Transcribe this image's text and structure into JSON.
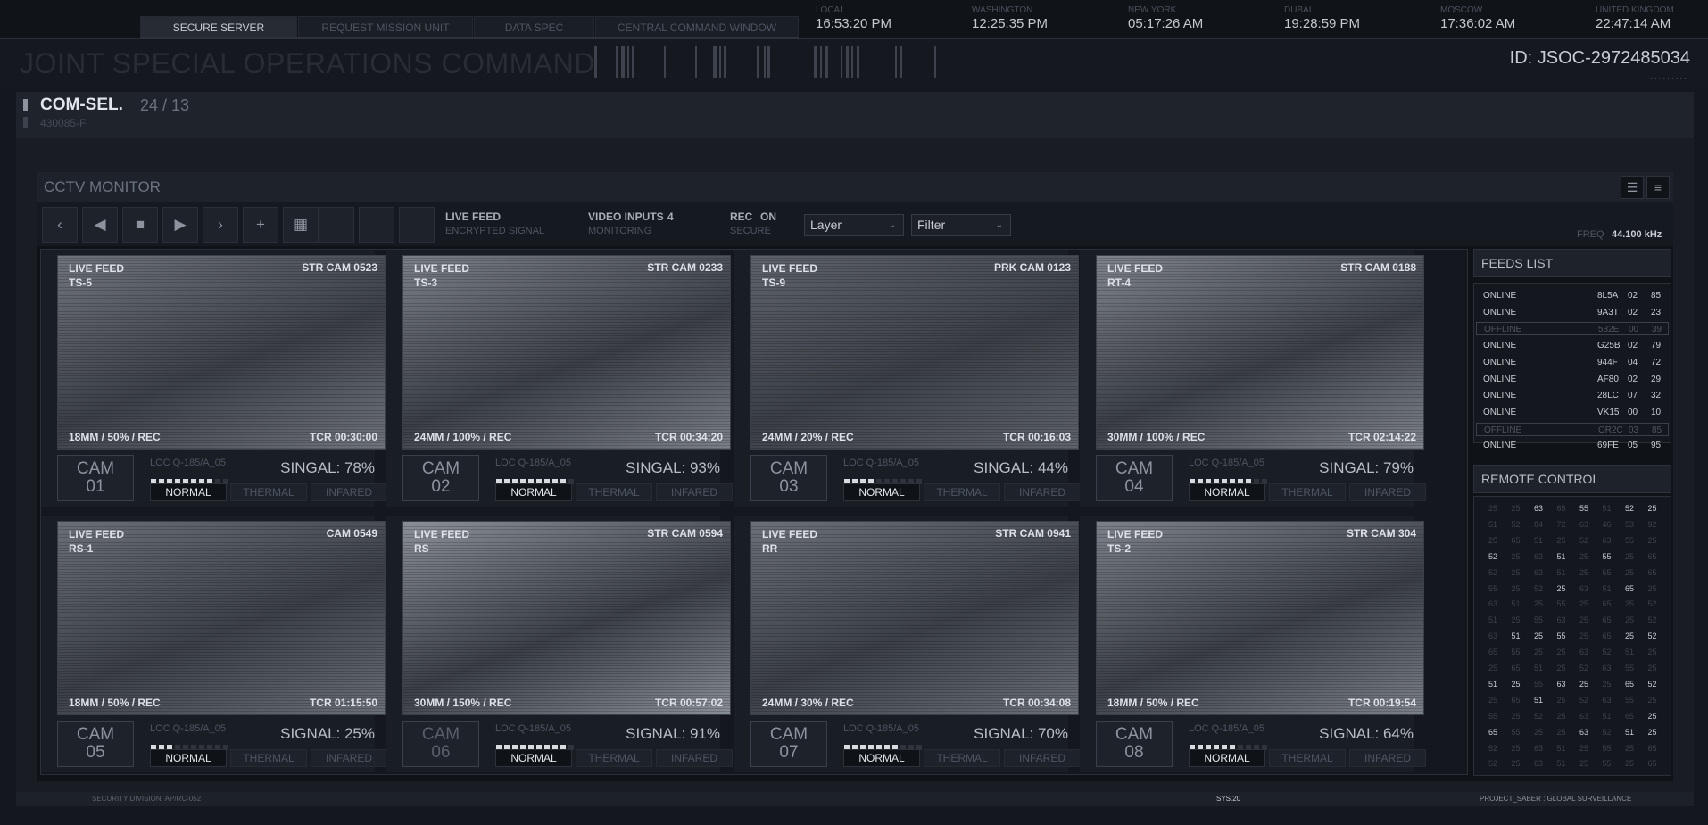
{
  "nav": {
    "tabs": [
      {
        "label": "SECURE SERVER"
      },
      {
        "label": "REQUEST MISSION UNIT"
      },
      {
        "label": "DATA SPEC"
      },
      {
        "label": "CENTRAL COMMAND WINDOW"
      }
    ]
  },
  "clocks": [
    {
      "city": "LOCAL",
      "time": "16:53:20  PM"
    },
    {
      "city": "WASHINGTON",
      "time": "12:25:35  PM"
    },
    {
      "city": "NEW YORK",
      "time": "05:17:26  AM"
    },
    {
      "city": "DUBAI",
      "time": "19:28:59  PM"
    },
    {
      "city": "MOSCOW",
      "time": "17:36:02  AM"
    },
    {
      "city": "UNITED KINGDOM",
      "time": "22:47:14  AM"
    }
  ],
  "header": {
    "title": "JOINT SPECIAL OPERATIONS COMMAND",
    "id_label": "ID:  JSOC-2972485034",
    "id_dots": "........."
  },
  "comsel": {
    "title": "COM-SEL.",
    "count": "24 / 13",
    "sub": "430085-F"
  },
  "cctv": {
    "title": "CCTV MONITOR",
    "live_feed": "LIVE FEED",
    "encrypted": "ENCRYPTED SIGNAL",
    "video_inputs": "VIDEO INPUTS",
    "video_inputs_count": "4",
    "monitoring": "MONITORING",
    "rec": "REC",
    "rec_status": "ON",
    "secure": "SECURE",
    "layer": "Layer",
    "filter": "Filter",
    "freq_label": "FREQ",
    "freq_value": "44.100 kHz"
  },
  "cameras": [
    {
      "tl1": "LIVE FEED",
      "tl2": "TS-5",
      "tr": "STR CAM 0523",
      "bl": "18MM / 50% / REC",
      "br": "TCR 00:30:00",
      "cam": "CAM",
      "num": "01",
      "loc": "LOC Q-185/A_05",
      "signal": "SINGAL: 78%",
      "level": 0.78,
      "shade": "#6f747c",
      "dim": false
    },
    {
      "tl1": "LIVE FEED",
      "tl2": "TS-3",
      "tr": "STR CAM 0233",
      "bl": "24MM / 100% / REC",
      "br": "TCR 00:34:20",
      "cam": "CAM",
      "num": "02",
      "loc": "LOC Q-185/A_05",
      "signal": "SINGAL: 93%",
      "level": 0.93,
      "shade": "#7a7f88",
      "dim": false
    },
    {
      "tl1": "LIVE FEED",
      "tl2": "TS-9",
      "tr": "PRK CAM 0123",
      "bl": "24MM / 20% / REC",
      "br": "TCR 00:16:03",
      "cam": "CAM",
      "num": "03",
      "loc": "LOC Q-185/A_05",
      "signal": "SINGAL: 44%",
      "level": 0.44,
      "shade": "#5e636b",
      "dim": false
    },
    {
      "tl1": "LIVE FEED",
      "tl2": "RT-4",
      "tr": "STR CAM 0188",
      "bl": "30MM / 100% / REC",
      "br": "TCR 02:14:22",
      "cam": "CAM",
      "num": "04",
      "loc": "LOC Q-185/A_05",
      "signal": "SINGAL: 79%",
      "level": 0.79,
      "shade": "#7f848c",
      "dim": false
    },
    {
      "tl1": "LIVE FEED",
      "tl2": "RS-1",
      "tr": "CAM 0549",
      "bl": "18MM / 50% / REC",
      "br": "TCR 01:15:50",
      "cam": "CAM",
      "num": "05",
      "loc": "LOC Q-185/A_05",
      "signal": "SIGNAL: 25%",
      "level": 0.25,
      "shade": "#6a6f77",
      "dim": false
    },
    {
      "tl1": "LIVE FEED",
      "tl2": "RS",
      "tr": "STR CAM 0594",
      "bl": "30MM / 150% / REC",
      "br": "TCR 00:57:02",
      "cam": "CAM",
      "num": "06",
      "loc": "LOC Q-185/A_05",
      "signal": "SIGNAL: 91%",
      "level": 0.91,
      "shade": "#8a8f97",
      "dim": true
    },
    {
      "tl1": "LIVE FEED",
      "tl2": "RR",
      "tr": "STR CAM 0941",
      "bl": "24MM / 30% / REC",
      "br": "TCR 00:34:08",
      "cam": "CAM",
      "num": "07",
      "loc": "LOC Q-185/A_05",
      "signal": "SIGNAL: 70%",
      "level": 0.7,
      "shade": "#6b7078",
      "dim": false
    },
    {
      "tl1": "LIVE FEED",
      "tl2": "TS-2",
      "tr": "STR CAM 304",
      "bl": "18MM / 50% / REC",
      "br": "TCR 00:19:54",
      "cam": "CAM",
      "num": "08",
      "loc": "LOC Q-185/A_05",
      "signal": "SIGNAL: 64%",
      "level": 0.64,
      "shade": "#7c8189",
      "dim": false
    }
  ],
  "modes": [
    "NORMAL",
    "THERMAL",
    "INFARED"
  ],
  "feeds_list": {
    "title": "FEEDS LIST",
    "rows": [
      {
        "status": "ONLINE",
        "code": "8L5A",
        "a": "02",
        "b": "85"
      },
      {
        "status": "ONLINE",
        "code": "9A3T",
        "a": "02",
        "b": "23"
      },
      {
        "status": "OFFLINE",
        "code": "532E",
        "a": "00",
        "b": "39"
      },
      {
        "status": "ONLINE",
        "code": "G25B",
        "a": "02",
        "b": "79"
      },
      {
        "status": "ONLINE",
        "code": "944F",
        "a": "04",
        "b": "72"
      },
      {
        "status": "ONLINE",
        "code": "AF80",
        "a": "02",
        "b": "29"
      },
      {
        "status": "ONLINE",
        "code": "28LC",
        "a": "07",
        "b": "32"
      },
      {
        "status": "ONLINE",
        "code": "VK15",
        "a": "00",
        "b": "10"
      },
      {
        "status": "OFFLINE",
        "code": "OR2C",
        "a": "03",
        "b": "85"
      },
      {
        "status": "ONLINE",
        "code": "69FE",
        "a": "05",
        "b": "95"
      }
    ]
  },
  "remote": {
    "title": "REMOTE CONTROL",
    "grid": [
      [
        "25",
        "25",
        "63",
        "65",
        "55",
        "51",
        "52",
        "25"
      ],
      [
        "51",
        "52",
        "84",
        "72",
        "63",
        "46",
        "53",
        "92"
      ],
      [
        "25",
        "65",
        "51",
        "25",
        "52",
        "63",
        "55",
        "25"
      ],
      [
        "52",
        "25",
        "63",
        "51",
        "25",
        "55",
        "25",
        "65"
      ],
      [
        "52",
        "25",
        "63",
        "51",
        "25",
        "55",
        "25",
        "65"
      ],
      [
        "55",
        "25",
        "52",
        "25",
        "63",
        "51",
        "65",
        "25"
      ],
      [
        "63",
        "51",
        "25",
        "55",
        "25",
        "65",
        "25",
        "52"
      ],
      [
        "51",
        "25",
        "55",
        "63",
        "25",
        "65",
        "25",
        "52"
      ],
      [
        "63",
        "51",
        "25",
        "55",
        "25",
        "65",
        "25",
        "52"
      ],
      [
        "65",
        "55",
        "25",
        "25",
        "63",
        "52",
        "51",
        "25"
      ],
      [
        "25",
        "65",
        "51",
        "25",
        "52",
        "63",
        "55",
        "25"
      ],
      [
        "51",
        "25",
        "55",
        "63",
        "25",
        "25",
        "65",
        "52"
      ],
      [
        "25",
        "65",
        "51",
        "25",
        "52",
        "63",
        "55",
        "25"
      ],
      [
        "55",
        "25",
        "52",
        "25",
        "63",
        "51",
        "65",
        "25"
      ],
      [
        "65",
        "55",
        "25",
        "25",
        "63",
        "52",
        "51",
        "25"
      ],
      [
        "52",
        "25",
        "63",
        "51",
        "25",
        "55",
        "25",
        "65"
      ],
      [
        "52",
        "25",
        "63",
        "51",
        "25",
        "55",
        "25",
        "65"
      ]
    ]
  },
  "footer": {
    "left": "SECURITY DIVISION: AP/RC-052",
    "mid": "SYS.20",
    "right": "PROJECT_SABER : GLOBAL SURVEILLANCE"
  }
}
